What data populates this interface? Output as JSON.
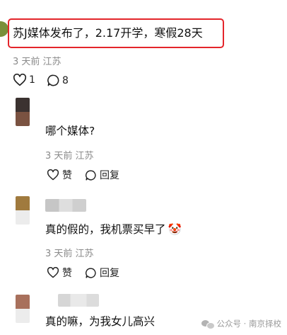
{
  "post": {
    "text": "苏J媒体发布了，2.17开学，寒假28天",
    "meta": "3 天前 江苏",
    "like_count": "1",
    "comment_count": "8"
  },
  "comments": [
    {
      "text": "哪个媒体?",
      "meta": "3 天前 江苏",
      "like_label": "赞",
      "reply_label": "回复",
      "avatar_colors": [
        "#3b3230",
        "#7a5241"
      ]
    },
    {
      "text": "真的假的，我机票买早了",
      "emoji": "🤡",
      "meta": "3 天前 江苏",
      "like_label": "赞",
      "reply_label": "回复",
      "avatar_colors": [
        "#a07a3e",
        "#ececec"
      ]
    },
    {
      "text": "真的嘛，为我女儿高兴",
      "avatar_colors": [
        "#a8705c",
        "#ececec"
      ]
    }
  ],
  "watermark": "公众号 · 南京择校",
  "colors": {
    "highlight_border": "#e4252b",
    "meta_text": "#8a8a8a"
  }
}
